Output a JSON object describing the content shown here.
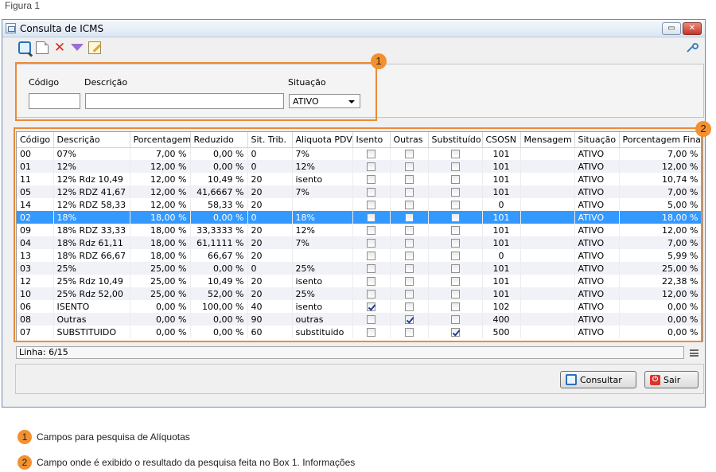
{
  "figure_label": "Figura 1",
  "window": {
    "title": "Consulta de ICMS",
    "restore_glyph": "▭",
    "close_glyph": "✕"
  },
  "toolbar": [
    "search-icon",
    "new-document-icon",
    "delete-icon",
    "filter-icon",
    "edit-icon"
  ],
  "search": {
    "codigo_label": "Código",
    "descricao_label": "Descrição",
    "situacao_label": "Situação",
    "codigo_value": "",
    "descricao_value": "",
    "situacao_value": "ATIVO"
  },
  "markers": {
    "one": "1",
    "two": "2"
  },
  "table": {
    "columns": [
      "Código",
      "Descrição",
      "Porcentagem",
      "Reduzido",
      "Sit. Trib.",
      "Aliquota PDV",
      "Isento",
      "Outras",
      "Substituído",
      "CSOSN",
      "Mensagem",
      "Situação",
      "Porcentagem Final"
    ],
    "rows": [
      {
        "codigo": "00",
        "descricao": "07%",
        "porcentagem": "7,00 %",
        "reduzido": "0,00 %",
        "sit_trib": "0",
        "aliquota_pdv": "7%",
        "isento": false,
        "outras": false,
        "substituido": false,
        "csosn": "101",
        "mensagem": "",
        "situacao": "ATIVO",
        "porcentagem_final": "7,00 %"
      },
      {
        "codigo": "01",
        "descricao": "12%",
        "porcentagem": "12,00 %",
        "reduzido": "0,00 %",
        "sit_trib": "0",
        "aliquota_pdv": "12%",
        "isento": false,
        "outras": false,
        "substituido": false,
        "csosn": "101",
        "mensagem": "",
        "situacao": "ATIVO",
        "porcentagem_final": "12,00 %"
      },
      {
        "codigo": "11",
        "descricao": "12%  Rdz 10,49",
        "porcentagem": "12,00 %",
        "reduzido": "10,49 %",
        "sit_trib": "20",
        "aliquota_pdv": "isento",
        "isento": false,
        "outras": false,
        "substituido": false,
        "csosn": "101",
        "mensagem": "",
        "situacao": "ATIVO",
        "porcentagem_final": "10,74 %"
      },
      {
        "codigo": "05",
        "descricao": "12%  RDZ 41,67",
        "porcentagem": "12,00 %",
        "reduzido": "41,6667 %",
        "sit_trib": "20",
        "aliquota_pdv": "7%",
        "isento": false,
        "outras": false,
        "substituido": false,
        "csosn": "101",
        "mensagem": "",
        "situacao": "ATIVO",
        "porcentagem_final": "7,00 %"
      },
      {
        "codigo": "14",
        "descricao": "12% RDZ 58,33",
        "porcentagem": "12,00 %",
        "reduzido": "58,33 %",
        "sit_trib": "20",
        "aliquota_pdv": "",
        "isento": false,
        "outras": false,
        "substituido": false,
        "csosn": "0",
        "mensagem": "",
        "situacao": "ATIVO",
        "porcentagem_final": "5,00 %"
      },
      {
        "codigo": "02",
        "descricao": "18%",
        "porcentagem": "18,00 %",
        "reduzido": "0,00 %",
        "sit_trib": "0",
        "aliquota_pdv": "18%",
        "isento": false,
        "outras": false,
        "substituido": false,
        "csosn": "101",
        "mensagem": "",
        "situacao": "ATIVO",
        "porcentagem_final": "18,00 %",
        "selected": true
      },
      {
        "codigo": "09",
        "descricao": "18%  RDZ 33,33",
        "porcentagem": "18,00 %",
        "reduzido": "33,3333 %",
        "sit_trib": "20",
        "aliquota_pdv": "12%",
        "isento": false,
        "outras": false,
        "substituido": false,
        "csosn": "101",
        "mensagem": "",
        "situacao": "ATIVO",
        "porcentagem_final": "12,00 %"
      },
      {
        "codigo": "04",
        "descricao": "18%  Rdz 61,11",
        "porcentagem": "18,00 %",
        "reduzido": "61,1111 %",
        "sit_trib": "20",
        "aliquota_pdv": "7%",
        "isento": false,
        "outras": false,
        "substituido": false,
        "csosn": "101",
        "mensagem": "",
        "situacao": "ATIVO",
        "porcentagem_final": "7,00 %"
      },
      {
        "codigo": "13",
        "descricao": "18% RDZ 66,67",
        "porcentagem": "18,00 %",
        "reduzido": "66,67 %",
        "sit_trib": "20",
        "aliquota_pdv": "",
        "isento": false,
        "outras": false,
        "substituido": false,
        "csosn": "0",
        "mensagem": "",
        "situacao": "ATIVO",
        "porcentagem_final": "5,99 %"
      },
      {
        "codigo": "03",
        "descricao": "25%",
        "porcentagem": "25,00 %",
        "reduzido": "0,00 %",
        "sit_trib": "0",
        "aliquota_pdv": "25%",
        "isento": false,
        "outras": false,
        "substituido": false,
        "csosn": "101",
        "mensagem": "",
        "situacao": "ATIVO",
        "porcentagem_final": "25,00 %"
      },
      {
        "codigo": "12",
        "descricao": "25% Rdz 10,49",
        "porcentagem": "25,00 %",
        "reduzido": "10,49 %",
        "sit_trib": "20",
        "aliquota_pdv": "isento",
        "isento": false,
        "outras": false,
        "substituido": false,
        "csosn": "101",
        "mensagem": "",
        "situacao": "ATIVO",
        "porcentagem_final": "22,38 %"
      },
      {
        "codigo": "10",
        "descricao": "25%  Rdz 52,00",
        "porcentagem": "25,00 %",
        "reduzido": "52,00 %",
        "sit_trib": "20",
        "aliquota_pdv": "25%",
        "isento": false,
        "outras": false,
        "substituido": false,
        "csosn": "101",
        "mensagem": "",
        "situacao": "ATIVO",
        "porcentagem_final": "12,00 %"
      },
      {
        "codigo": "06",
        "descricao": "ISENTO",
        "porcentagem": "0,00 %",
        "reduzido": "100,00 %",
        "sit_trib": "40",
        "aliquota_pdv": "isento",
        "isento": true,
        "outras": false,
        "substituido": false,
        "csosn": "102",
        "mensagem": "",
        "situacao": "ATIVO",
        "porcentagem_final": "0,00 %"
      },
      {
        "codigo": "08",
        "descricao": "Outras",
        "porcentagem": "0,00 %",
        "reduzido": "0,00 %",
        "sit_trib": "90",
        "aliquota_pdv": "outras",
        "isento": false,
        "outras": true,
        "substituido": false,
        "csosn": "400",
        "mensagem": "",
        "situacao": "ATIVO",
        "porcentagem_final": "0,00 %"
      },
      {
        "codigo": "07",
        "descricao": "SUBSTITUIDO",
        "porcentagem": "0,00 %",
        "reduzido": "0,00 %",
        "sit_trib": "60",
        "aliquota_pdv": "substituido",
        "isento": false,
        "outras": false,
        "substituido": true,
        "csosn": "500",
        "mensagem": "",
        "situacao": "ATIVO",
        "porcentagem_final": "0,00 %"
      }
    ]
  },
  "status": {
    "linha": "Linha: 6/15"
  },
  "buttons": {
    "consultar": "Consultar",
    "sair": "Sair"
  },
  "legend": {
    "item1": "Campos para pesquisa de Alíquotas",
    "item2": "Campo onde é exibido o resultado da pesquisa feita no Box 1. Informações"
  },
  "colors": {
    "accent_orange": "#f39030",
    "selection_blue": "#3399ff"
  }
}
